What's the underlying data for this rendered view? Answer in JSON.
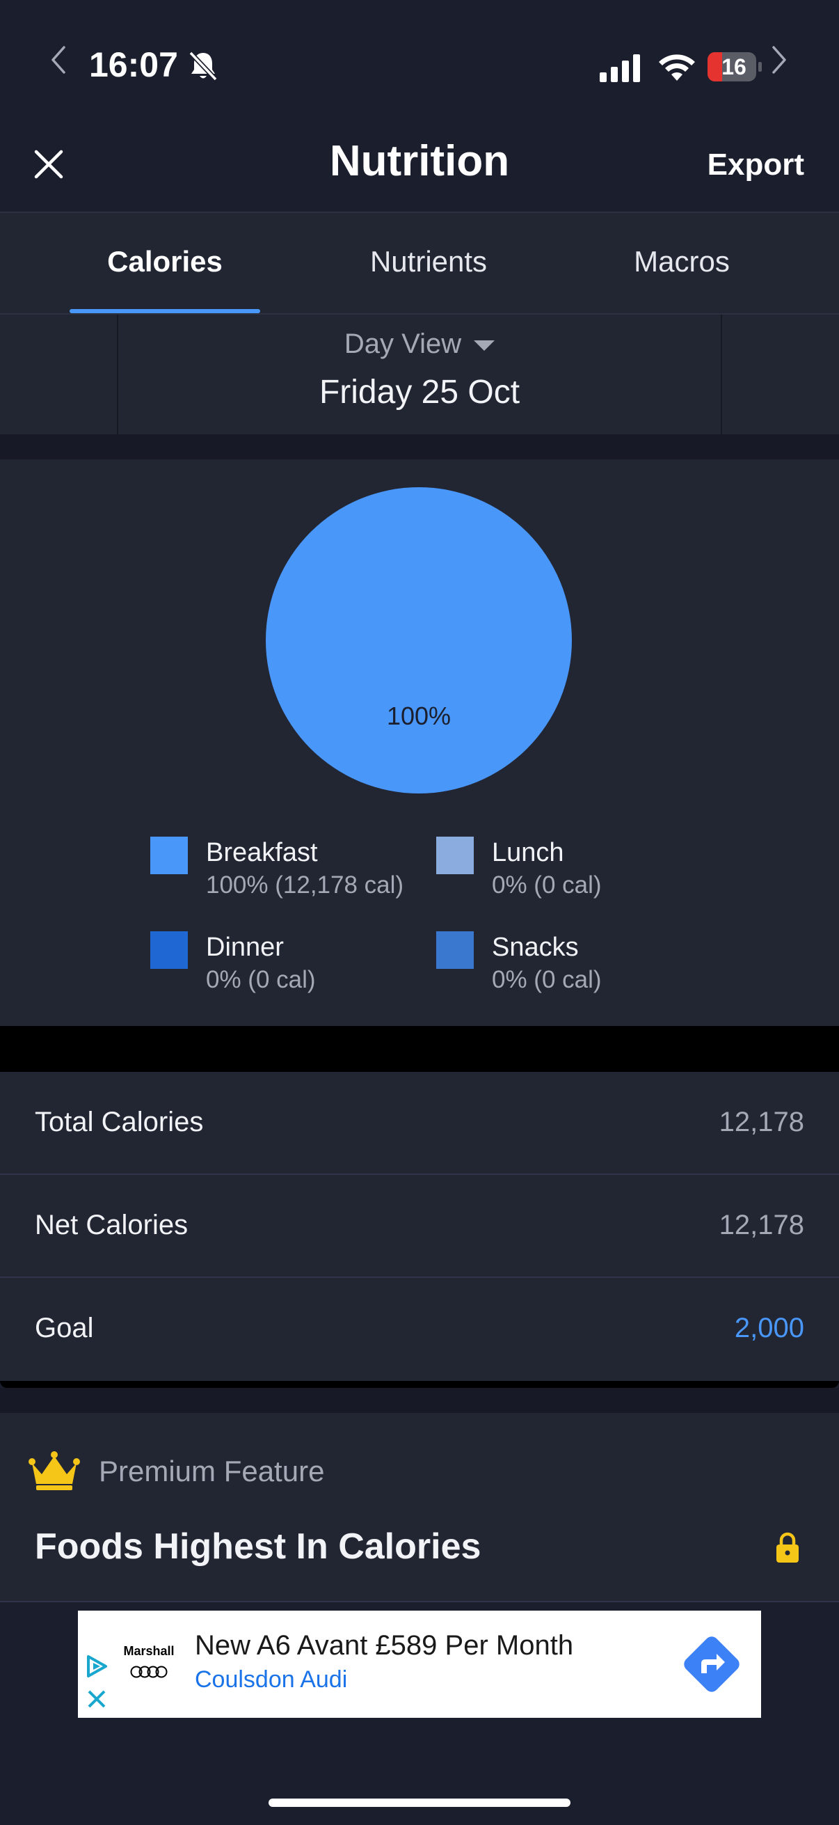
{
  "status_bar": {
    "time": "16:07",
    "battery": "16"
  },
  "header": {
    "title": "Nutrition",
    "export_label": "Export"
  },
  "tabs": [
    {
      "label": "Calories",
      "active": true
    },
    {
      "label": "Nutrients",
      "active": false
    },
    {
      "label": "Macros",
      "active": false
    }
  ],
  "date_nav": {
    "view_label": "Day View",
    "date": "Friday 25 Oct"
  },
  "chart_data": {
    "type": "pie",
    "slices": [
      {
        "name": "Breakfast",
        "percent": 100,
        "value": 12178,
        "color": "#4a97fa"
      },
      {
        "name": "Lunch",
        "percent": 0,
        "value": 0,
        "color": "#8aacde"
      },
      {
        "name": "Dinner",
        "percent": 0,
        "value": 0,
        "color": "#1f68d4"
      },
      {
        "name": "Snacks",
        "percent": 0,
        "value": 0,
        "color": "#3a78d0"
      }
    ],
    "center_label": "100%"
  },
  "legend": [
    {
      "name": "Breakfast",
      "value": "100% (12,178 cal)",
      "color": "#4a97fa"
    },
    {
      "name": "Lunch",
      "value": "0% (0 cal)",
      "color": "#8aacde"
    },
    {
      "name": "Dinner",
      "value": "0% (0 cal)",
      "color": "#1f68d4"
    },
    {
      "name": "Snacks",
      "value": "0% (0 cal)",
      "color": "#3a78d0"
    }
  ],
  "summary": [
    {
      "label": "Total Calories",
      "value": "12,178"
    },
    {
      "label": "Net Calories",
      "value": "12,178"
    },
    {
      "label": "Goal",
      "value": "2,000"
    }
  ],
  "premium": {
    "label": "Premium Feature",
    "title": "Foods Highest In Calories"
  },
  "ad": {
    "brand": "Marshall",
    "title": "New A6 Avant £589 Per Month",
    "subtitle": "Coulsdon Audi"
  },
  "colors": {
    "accent": "#4a97fa",
    "crown": "#f5c518",
    "lock": "#f5c518"
  }
}
